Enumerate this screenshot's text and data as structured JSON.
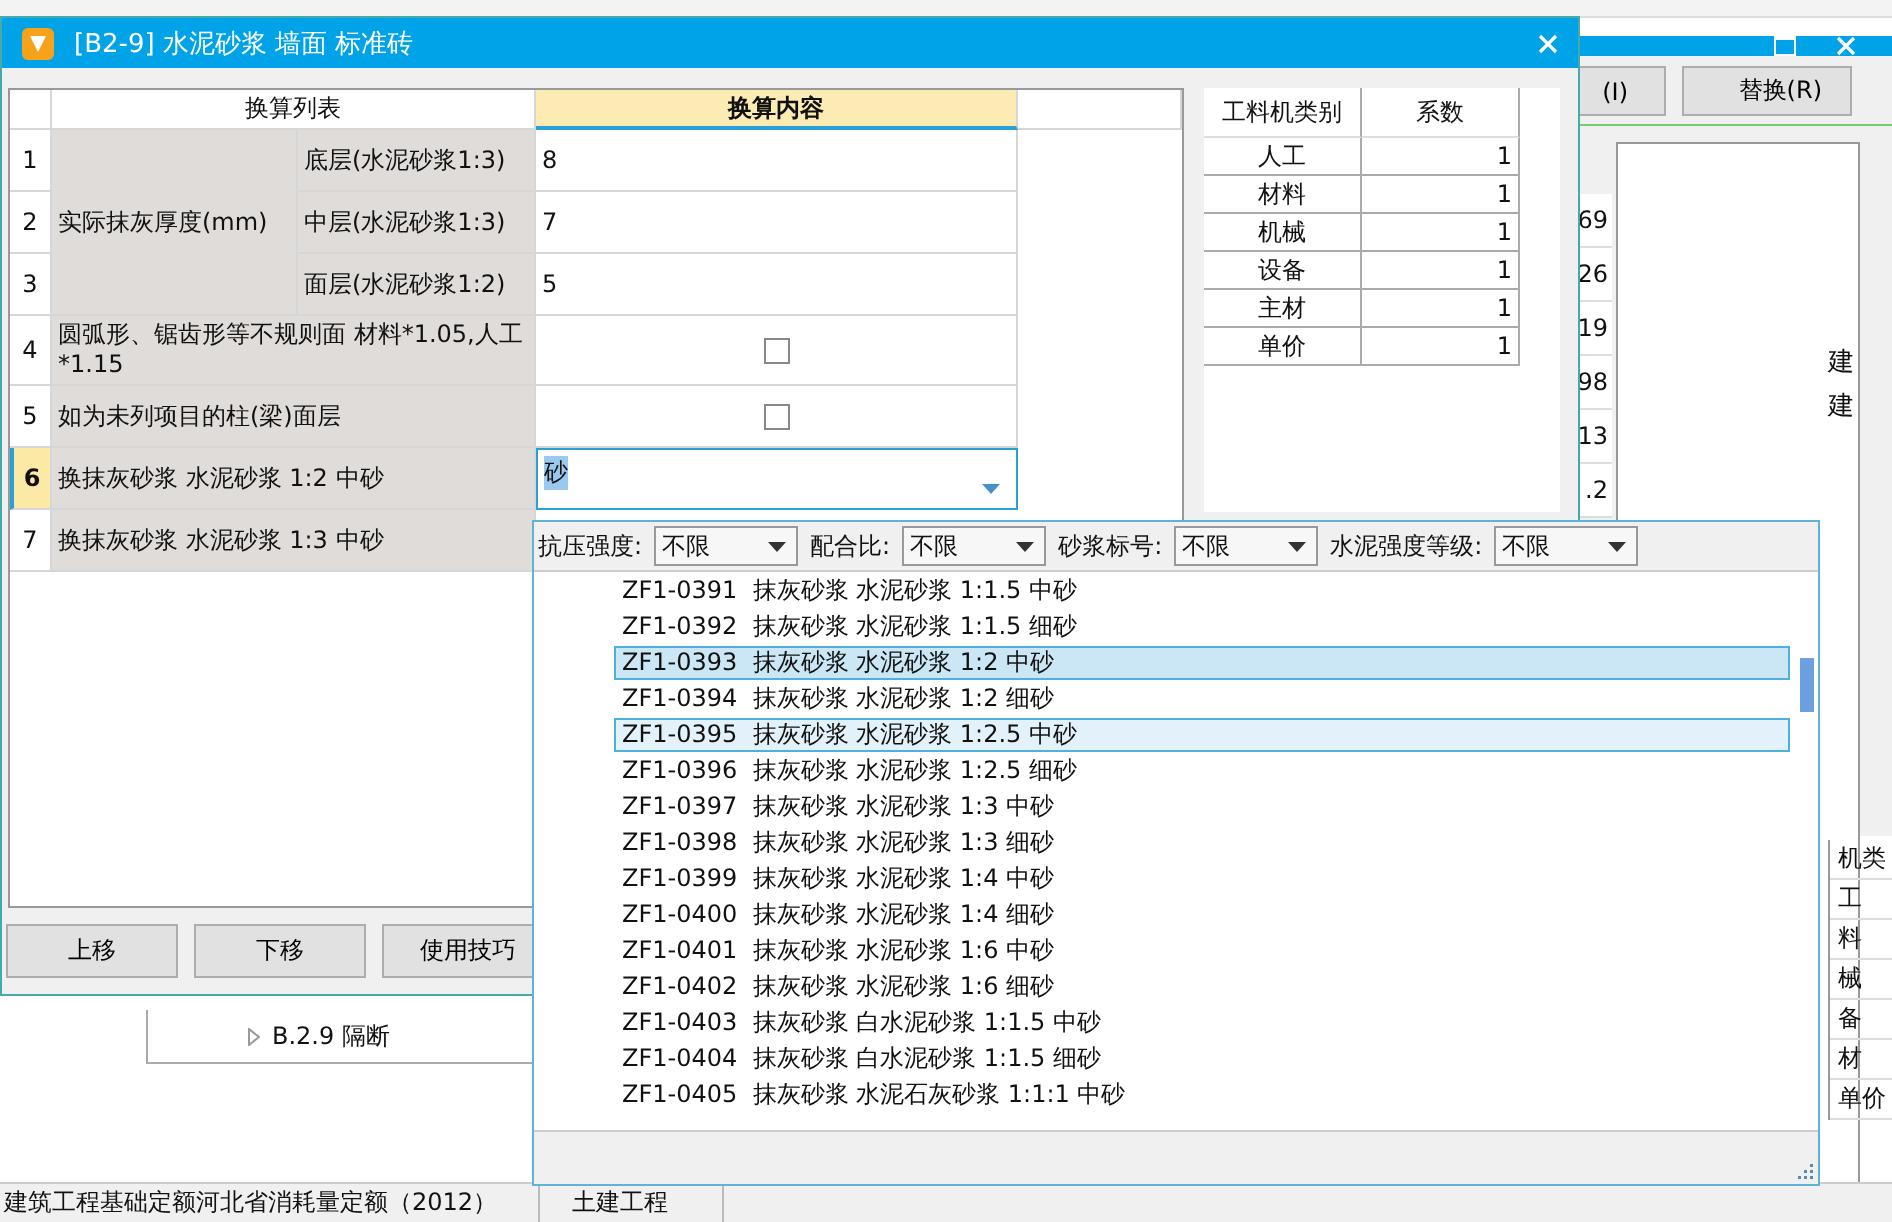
{
  "background_app": {
    "tree_item": {
      "label": "B.2.9 隔断"
    },
    "side_labels": [
      "机类",
      "工",
      "料",
      "械",
      "备",
      "材",
      "单价"
    ],
    "status_bar": [
      "建筑工程基础定额河北省消耗量定额（2012）",
      "土建工程"
    ]
  },
  "second_window": {
    "buttons": [
      "(I)",
      "替换(R)"
    ],
    "values": [
      "69",
      "26",
      "19",
      "98",
      "13",
      ".2"
    ],
    "labels": [
      "建",
      "建"
    ]
  },
  "dialog": {
    "title": "[B2-9] 水泥砂浆 墙面 标准砖",
    "table": {
      "columns": [
        "换算列表",
        "换算内容"
      ],
      "group_label": "实际抹灰厚度(mm)",
      "rows": [
        {
          "number": "1",
          "sublabel": "底层(水泥砂浆1:3)",
          "kind": "text",
          "value": "8",
          "selected": false
        },
        {
          "number": "2",
          "sublabel": "中层(水泥砂浆1:3)",
          "kind": "text",
          "value": "7",
          "selected": false
        },
        {
          "number": "3",
          "sublabel": "面层(水泥砂浆1:2)",
          "kind": "text",
          "value": "5",
          "selected": false
        },
        {
          "number": "4",
          "label": "圆弧形、锯齿形等不规则面 材料*1.05,人工*1.15",
          "kind": "checkbox",
          "checked": false,
          "selected": false
        },
        {
          "number": "5",
          "label": "如为未列项目的柱(梁)面层",
          "kind": "checkbox",
          "checked": false,
          "selected": false
        },
        {
          "number": "6",
          "label": "换抹灰砂浆 水泥砂浆 1:2 中砂",
          "kind": "combo",
          "value": "砂",
          "selected": true
        },
        {
          "number": "7",
          "label": "换抹灰砂浆 水泥砂浆 1:3 中砂",
          "kind": "covered",
          "selected": false
        }
      ]
    },
    "factor_table": {
      "columns": [
        "工料机类别",
        "系数"
      ],
      "rows": [
        {
          "category": "人工",
          "value": "1"
        },
        {
          "category": "材料",
          "value": "1"
        },
        {
          "category": "机械",
          "value": "1"
        },
        {
          "category": "设备",
          "value": "1"
        },
        {
          "category": "主材",
          "value": "1"
        },
        {
          "category": "单价",
          "value": "1"
        }
      ]
    },
    "buttons": [
      "上移",
      "下移",
      "使用技巧"
    ]
  },
  "dropdown": {
    "filters": [
      {
        "label": "抗压强度:",
        "value": "不限"
      },
      {
        "label": "配合比:",
        "value": "不限"
      },
      {
        "label": "砂浆标号:",
        "value": "不限"
      },
      {
        "label": "水泥强度等级:",
        "value": "不限"
      }
    ],
    "items": [
      {
        "code": "ZF1-0391",
        "name": "抹灰砂浆 水泥砂浆 1:1.5 中砂",
        "selected": false,
        "hovered": false
      },
      {
        "code": "ZF1-0392",
        "name": "抹灰砂浆 水泥砂浆 1:1.5 细砂",
        "selected": false,
        "hovered": false
      },
      {
        "code": "ZF1-0393",
        "name": "抹灰砂浆 水泥砂浆 1:2 中砂",
        "selected": true,
        "hovered": false
      },
      {
        "code": "ZF1-0394",
        "name": "抹灰砂浆 水泥砂浆 1:2 细砂",
        "selected": false,
        "hovered": false
      },
      {
        "code": "ZF1-0395",
        "name": "抹灰砂浆 水泥砂浆 1:2.5 中砂",
        "selected": false,
        "hovered": true
      },
      {
        "code": "ZF1-0396",
        "name": "抹灰砂浆 水泥砂浆 1:2.5 细砂",
        "selected": false,
        "hovered": false
      },
      {
        "code": "ZF1-0397",
        "name": "抹灰砂浆 水泥砂浆 1:3 中砂",
        "selected": false,
        "hovered": false
      },
      {
        "code": "ZF1-0398",
        "name": "抹灰砂浆 水泥砂浆 1:3 细砂",
        "selected": false,
        "hovered": false
      },
      {
        "code": "ZF1-0399",
        "name": "抹灰砂浆 水泥砂浆 1:4 中砂",
        "selected": false,
        "hovered": false
      },
      {
        "code": "ZF1-0400",
        "name": "抹灰砂浆 水泥砂浆 1:4 细砂",
        "selected": false,
        "hovered": false
      },
      {
        "code": "ZF1-0401",
        "name": "抹灰砂浆 水泥砂浆 1:6 中砂",
        "selected": false,
        "hovered": false
      },
      {
        "code": "ZF1-0402",
        "name": "抹灰砂浆 水泥砂浆 1:6 细砂",
        "selected": false,
        "hovered": false
      },
      {
        "code": "ZF1-0403",
        "name": "抹灰砂浆 白水泥砂浆 1:1.5 中砂",
        "selected": false,
        "hovered": false
      },
      {
        "code": "ZF1-0404",
        "name": "抹灰砂浆 白水泥砂浆 1:1.5 细砂",
        "selected": false,
        "hovered": false
      },
      {
        "code": "ZF1-0405",
        "name": "抹灰砂浆 水泥石灰砂浆 1:1:1 中砂",
        "selected": false,
        "hovered": false
      }
    ]
  }
}
